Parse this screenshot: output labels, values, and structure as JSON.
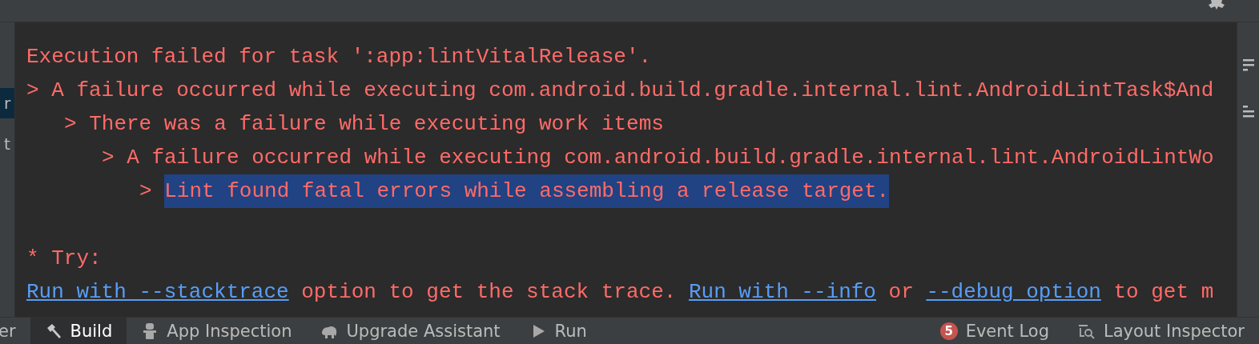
{
  "left_panel": {
    "items": [
      {
        "label": "r",
        "selected": true
      },
      {
        "label": "t",
        "selected": false
      }
    ]
  },
  "console": {
    "error": "Execution failed for task ':app:lintVitalRelease'.",
    "causes": [
      {
        "prefix": ">",
        "text": "A failure occurred while executing com.android.build.gradle.internal.lint.AndroidLintTask$And",
        "selected": false,
        "children": [
          {
            "prefix": ">",
            "text": "There was a failure while executing work items",
            "selected": false,
            "children": [
              {
                "prefix": ">",
                "text": "A failure occurred while executing com.android.build.gradle.internal.lint.AndroidLintWo",
                "selected": false,
                "children": [
                  {
                    "prefix": ">",
                    "text": "Lint found fatal errors while assembling a release target.",
                    "selected": true
                  }
                ]
              }
            ]
          }
        ]
      }
    ],
    "try_heading": "* Try:",
    "hint": [
      {
        "kind": "link",
        "text": "Run with --stacktrace"
      },
      {
        "kind": "text",
        "text": " option to get the stack trace. "
      },
      {
        "kind": "link",
        "text": "Run with --info"
      },
      {
        "kind": "text",
        "text": " or "
      },
      {
        "kind": "link",
        "text": "--debug option"
      },
      {
        "kind": "text",
        "text": " to get m"
      }
    ]
  },
  "tool_tabs": [
    {
      "label": "er",
      "kind": "plain",
      "selected": false
    },
    {
      "label": "Build",
      "kind": "hammer",
      "selected": true
    },
    {
      "label": "App Inspection",
      "kind": "robot",
      "selected": false
    },
    {
      "label": "Upgrade Assistant",
      "kind": "elephant",
      "selected": false
    },
    {
      "label": "Run",
      "kind": "play",
      "selected": false
    }
  ],
  "right_tabs": [
    {
      "label": "Event Log",
      "badge": "5",
      "kind": "badge"
    },
    {
      "label": "Layout Inspector",
      "kind": "inspector"
    }
  ]
}
